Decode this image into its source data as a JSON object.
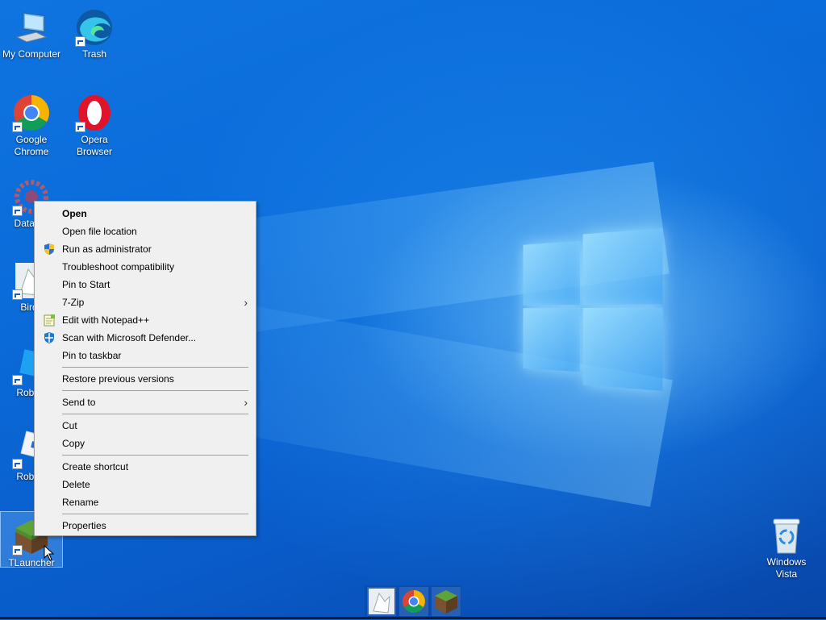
{
  "desktop": {
    "icons": [
      {
        "label": "My Computer",
        "icon": "computer-icon"
      },
      {
        "label": "Trash",
        "icon": "edge-icon"
      },
      {
        "label": "Google Chrome",
        "icon": "chrome-icon"
      },
      {
        "label": "Opera Browser",
        "icon": "opera-icon"
      },
      {
        "label": "DataWa",
        "icon": "datawarp-icon"
      },
      {
        "label": "Birdy",
        "icon": "birdy-icon"
      },
      {
        "label": "Roblox",
        "icon": "roblox-icon"
      },
      {
        "label": "Roblox",
        "icon": "roblox-studio-icon"
      },
      {
        "label": "TLauncher",
        "icon": "grass-block-icon"
      },
      {
        "label": "Windows Vista",
        "icon": "recycle-bin-icon"
      }
    ]
  },
  "context_menu": {
    "items": [
      {
        "label": "Open"
      },
      {
        "label": "Open file location"
      },
      {
        "label": "Run as administrator",
        "icon": "uac-shield-icon"
      },
      {
        "label": "Troubleshoot compatibility"
      },
      {
        "label": "Pin to Start"
      },
      {
        "label": "7-Zip",
        "submenu": true
      },
      {
        "label": "Edit with Notepad++",
        "icon": "notepad-plus-plus-icon"
      },
      {
        "label": "Scan with Microsoft Defender...",
        "icon": "defender-icon"
      },
      {
        "label": "Pin to taskbar"
      },
      {
        "label": "Restore previous versions"
      },
      {
        "label": "Send to",
        "submenu": true
      },
      {
        "label": "Cut"
      },
      {
        "label": "Copy"
      },
      {
        "label": "Create shortcut"
      },
      {
        "label": "Delete"
      },
      {
        "label": "Rename"
      },
      {
        "label": "Properties"
      }
    ],
    "submenu_arrow": "›"
  },
  "taskbar": {
    "pinned": [
      "birdy-icon",
      "chrome-icon",
      "grass-block-icon"
    ]
  },
  "colors": {
    "desktop_blue": "#0a63d6",
    "menu_bg": "#f0f0f0"
  }
}
